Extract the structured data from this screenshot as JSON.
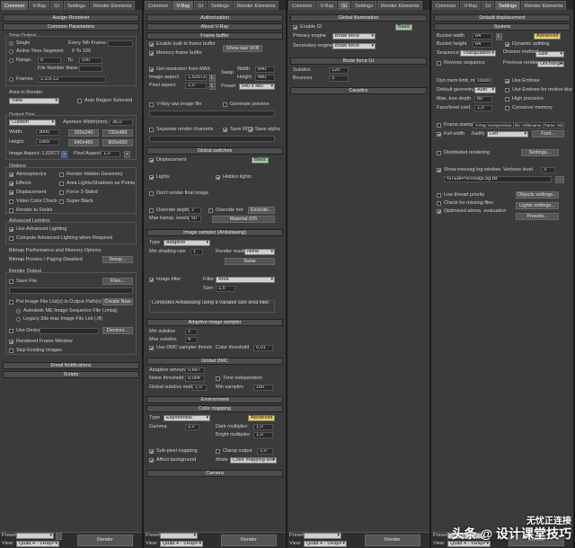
{
  "tabs": {
    "p1": [
      "Common",
      "V-Ray",
      "GI",
      "Settings",
      "Render Elements"
    ],
    "p2": [
      "Common",
      "V-Ray",
      "GI",
      "Settings",
      "Render Elements"
    ],
    "p3": [
      "Common",
      "V-Ray",
      "GI",
      "Settings",
      "Render Elements"
    ],
    "p4": [
      "Common",
      "V-Ray",
      "GI",
      "Settings",
      "Render Elements"
    ]
  },
  "p1": {
    "assign": "Assign Renderer",
    "common": "Common Parameters",
    "time_output": "Time Output",
    "single": "Single",
    "every_nth": "Every Nth Frame:",
    "active_time": "Active Time Segment:",
    "active_range": "0 To 100",
    "range": "Range:",
    "range_from": "0",
    "to": "To",
    "range_to": "100",
    "file_base": "File Number Base:",
    "frames": "Frames",
    "frames_val": "1,3,5-12",
    "area": "Area to Render",
    "area_val": "View",
    "auto_region": "Auto Region Selected",
    "output_size": "Output Size",
    "size_preset": "Custom",
    "aperture": "Aperture Width(mm):",
    "aperture_val": "36,0",
    "width": "Width:",
    "width_val": "3000",
    "height": "Height:",
    "height_val": "1965",
    "presets": [
      "320x240",
      "720x486",
      "640x480",
      "800x600"
    ],
    "aspect": "Image Aspect: 1,52672",
    "pixel_aspect": "Pixel Aspect:",
    "pixel_aspect_val": "1,0",
    "options": "Options",
    "atmospherics": "Atmospherics",
    "render_hidden": "Render Hidden Geometry",
    "effects": "Effects",
    "area_lights": "Area Lights/Shadows as Points",
    "displacement": "Displacement",
    "force_2sided": "Force 2-Sided",
    "video_color": "Video Color Check",
    "super_black": "Super Black",
    "render_fields": "Render to Fields",
    "adv_lighting": "Advanced Lighting",
    "use_adv": "Use Advanced Lighting",
    "compute_adv": "Compute Advanced Lighting when Required",
    "bitmap_perf": "Bitmap Performance and Memory Options",
    "bitmap_proxies": "Bitmap Proxies / Paging Disabled",
    "setup": "Setup...",
    "render_output": "Render Output",
    "save_file": "Save File",
    "files": "Files...",
    "put_image": "Put Image File List(s) in Output Path(s)",
    "create_now": "Create Now",
    "autodesk_seq": "Autodesk ME Image Sequence File (.imsq)",
    "legacy": "Legacy 3ds max Image File List (.ifl)",
    "use_device": "Use Device",
    "devices": "Devices...",
    "rendered_frame": "Rendered Frame Window",
    "skip_existing": "Skip Existing Images",
    "email": "Email Notifications",
    "scripts": "Scripts"
  },
  "p2": {
    "authorization": "Authorization",
    "about": "About V-Ray",
    "frame_buffer": "Frame buffer",
    "enable_fb": "Enable built-in frame buffer",
    "mem_fb": "Memory frame buffer",
    "show_last": "Show last VFB",
    "get_res": "Get resolution from MAX",
    "image_aspect": "Image aspect",
    "image_aspect_val": "1,52672",
    "pixel_aspect": "Pixel aspect",
    "pixel_aspect_val": "1,0",
    "swap": "Swap",
    "width": "Width",
    "width_val": "640",
    "height": "Height",
    "height_val": "480",
    "preset": "Preset",
    "preset_val": "640 x 480",
    "raw": "V-Ray raw image file",
    "gen_preview": "Generate preview",
    "sep_channels": "Separate render channels",
    "save_rgb": "Save RGB",
    "save_alpha": "Save alpha",
    "global_switches": "Global switches",
    "displacement": "Displacement",
    "basic": "Basic",
    "lights": "Lights",
    "hidden_lights": "Hidden lights",
    "dont_render": "Don't render final image",
    "override_depth": "Override depth",
    "override_depth_val": "2",
    "override_mtl": "Override mtl:",
    "exclude": "Exclude...",
    "max_transp": "Max transp. levels",
    "max_transp_val": "50",
    "material": "Material #25",
    "image_sampler": "Image sampler (Antialiasing)",
    "type": "Type",
    "type_val": "Adaptive",
    "min_shading": "Min shading rate",
    "min_shading_val": "1",
    "render_mask": "Render mask",
    "render_mask_val": "None",
    "none_btn": "None",
    "image_filter": "Image filter",
    "filter": "Filter",
    "filter_val": "Area",
    "size": "Size:",
    "size_val": "1,5",
    "filter_desc": "Computes Antialiasing using a variable size area filter.",
    "adaptive": "Adaptive image sampler",
    "min_subdivs": "Min subdivs",
    "min_subdivs_val": "1",
    "max_subdivs": "Max subdivs",
    "max_subdivs_val": "4",
    "use_dmc": "Use DMC sampler thresh.",
    "color_thresh": "Color threshold",
    "color_thresh_val": "0,01",
    "global_dmc": "Global DMC",
    "adaptive_amount": "Adaptive amount",
    "adaptive_amount_val": "0,667",
    "noise": "Noise threshold",
    "noise_val": "0,004",
    "time_indep": "Time independent",
    "global_subdivs": "Global subdivs mult.",
    "global_subdivs_val": "1,0",
    "min_samples": "Min samples",
    "min_samples_val": "150",
    "environment": "Environment",
    "color_mapping": "Color mapping",
    "cm_type": "Type",
    "cm_type_val": "Exponential",
    "advanced": "Advanced",
    "gamma": "Gamma",
    "gamma_val": "2,2",
    "dark_mult": "Dark multiplier:",
    "dark_val": "1,0",
    "bright_mult": "Bright multiplier:",
    "bright_val": "1,0",
    "subpixel": "Sub-pixel mapping",
    "clamp": "Clamp output",
    "clamp_val": "1,0",
    "affect_bg": "Affect background",
    "mode": "Mode",
    "mode_val": "Color mapping and gamma",
    "camera": "Camera"
  },
  "p3": {
    "gi": "Global illumination",
    "enable_gi": "Enable GI",
    "basic": "Basic",
    "primary": "Primary engine",
    "primary_val": "Brute force",
    "secondary": "Secondary engine",
    "secondary_val": "Brute force",
    "brute": "Brute force GI",
    "subdivs": "Subdivs",
    "subdivs_val": "120",
    "bounces": "Bounces",
    "bounces_val": "3",
    "caustics": "Caustics"
  },
  "p4": {
    "default_disp": "Default displacement",
    "system": "System",
    "bucket_w": "Bucket width",
    "bucket_w_val": "64",
    "L": "L",
    "advanced": "Advanced",
    "bucket_h": "Bucket height",
    "bucket_h_val": "64",
    "dyn_split": "Dynamic splitting",
    "sequence": "Sequence",
    "sequence_val": "Triangulation",
    "division": "Division method",
    "division_val": "Size",
    "reverse": "Reverse sequence",
    "prev_render": "Previous render",
    "prev_render_val": "Unchanged",
    "dyn_mem": "Dyn mem limit, mb",
    "dyn_mem_val": "16000",
    "use_embree": "Use Embree",
    "default_geo": "Default geometry",
    "default_geo_val": "Auto",
    "embree_blur": "Use Embree for motion blur",
    "max_tree": "Max. tree depth",
    "max_tree_val": "80",
    "high_prec": "High precision",
    "face_level": "Face/level coef.",
    "face_level_val": "1,0",
    "conserve": "Conserve memory",
    "frame_stamp": "Frame stamp",
    "stamp_text": "V-Ray %vrayversion | file: %filename | frame: %frame",
    "full_width": "Full width",
    "justify": "Justify",
    "justify_val": "Left",
    "font": "Font...",
    "distributed": "Distributed rendering",
    "settings": "Settings...",
    "show_log": "Show messag log window",
    "verbose": "Verbose level",
    "verbose_val": "3",
    "log_path": "%TEMP%\\VRayLog.txt",
    "low_thread": "Low thread priority",
    "objects_settings": "Objects settings...",
    "check_missing": "Check for missing files",
    "lights_settings": "Lights settings...",
    "optimized": "Optimized atmos. evaluation",
    "presets": "Presets..."
  },
  "footer": {
    "preset": "Preset:",
    "view": "View:",
    "view_val": "Quad 4 - VRayP",
    "render": "Render"
  },
  "watermark": {
    "brand": "头条",
    "text": "@ 设计课堂技巧",
    "site": "无忧正连接"
  }
}
